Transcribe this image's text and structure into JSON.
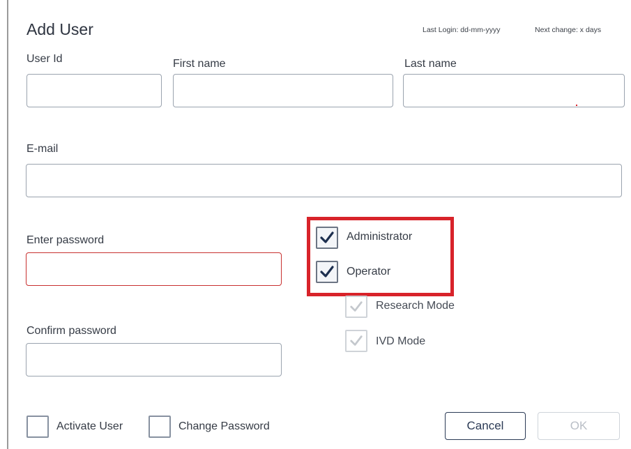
{
  "dialog": {
    "title": "Add User",
    "last_login": "Last Login: dd-mm-yyyy",
    "next_change": "Next change: x days"
  },
  "fields": {
    "user_id": {
      "label": "User Id",
      "value": ""
    },
    "first_name": {
      "label": "First name",
      "value": ""
    },
    "last_name": {
      "label": "Last name",
      "value": ""
    },
    "email": {
      "label": "E-mail",
      "value": ""
    },
    "enter_password": {
      "label": "Enter password",
      "value": "",
      "state": "error"
    },
    "confirm_password": {
      "label": "Confirm password",
      "value": ""
    }
  },
  "roles": {
    "administrator": {
      "label": "Administrator",
      "checked": true
    },
    "operator": {
      "label": "Operator",
      "checked": true
    },
    "research_mode": {
      "label": "Research Mode",
      "checked": true,
      "disabled": true
    },
    "ivd_mode": {
      "label": "IVD Mode",
      "checked": true,
      "disabled": true
    }
  },
  "options": {
    "activate_user": {
      "label": "Activate User",
      "checked": false
    },
    "change_password": {
      "label": "Change Password",
      "checked": false
    }
  },
  "buttons": {
    "cancel": "Cancel",
    "ok": "OK"
  },
  "colors": {
    "highlight": "#d8232a",
    "check_dark": "#1d2f4f",
    "check_disabled": "#c4c8cd",
    "error_border": "#c8302f"
  }
}
